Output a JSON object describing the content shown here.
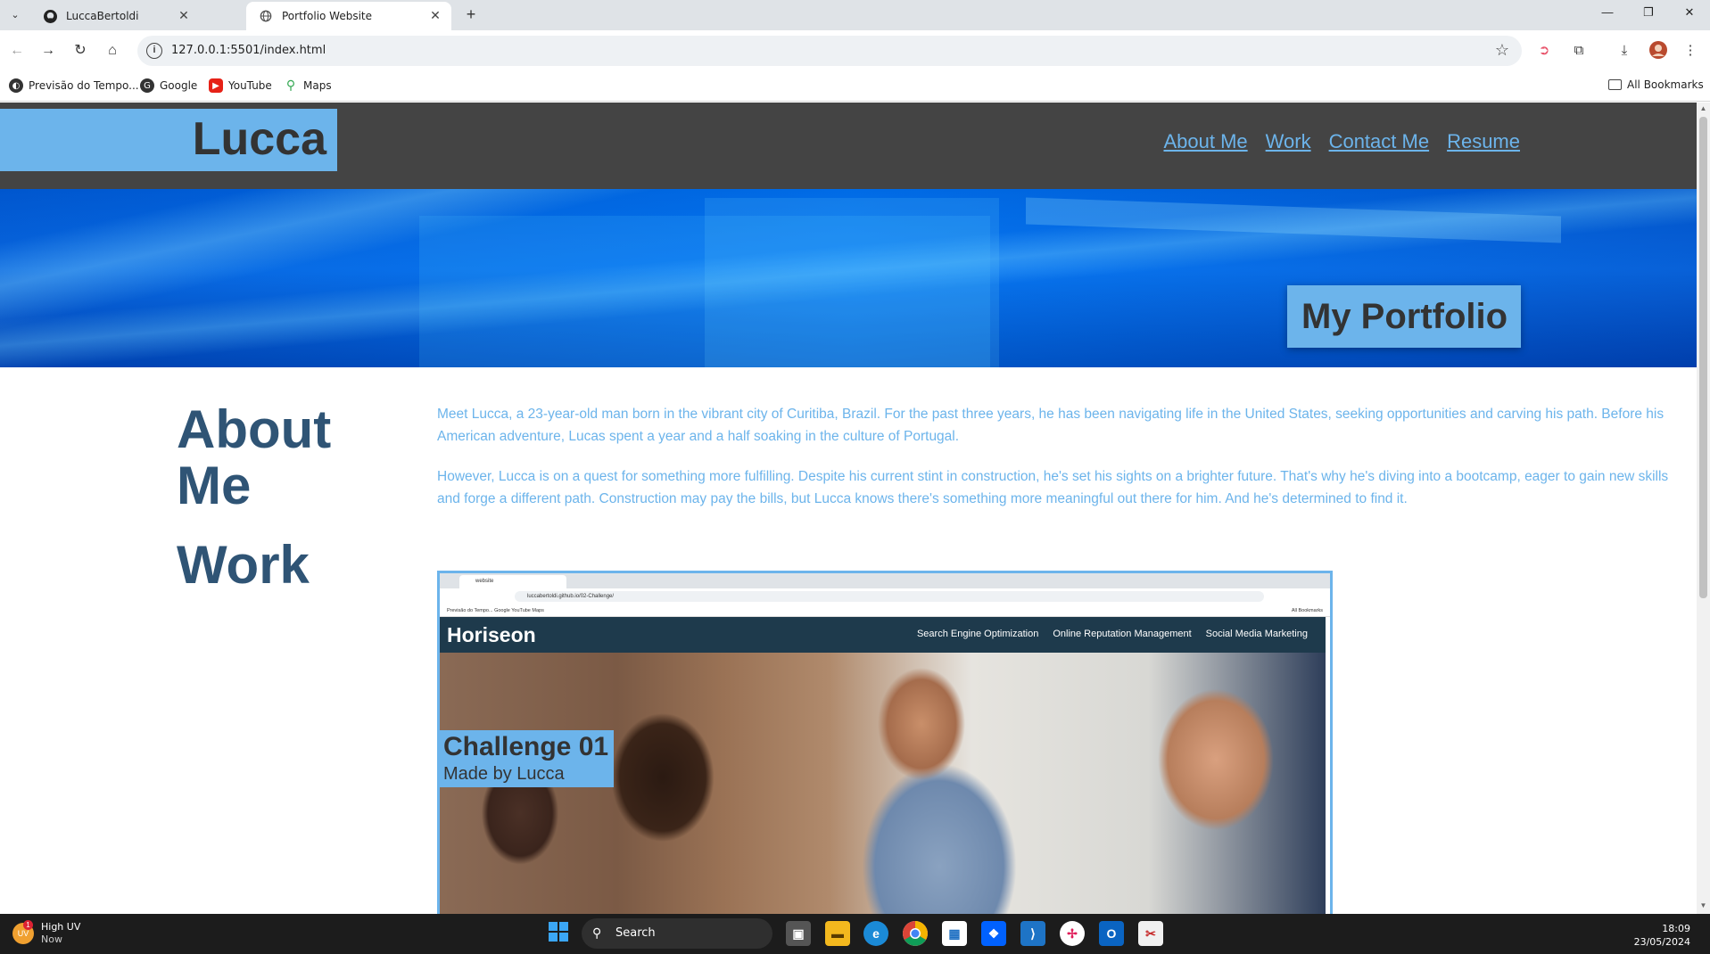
{
  "browser": {
    "tabs": [
      {
        "title": "LuccaBertoldi",
        "icon": "github-icon",
        "active": false
      },
      {
        "title": "Portfolio Website",
        "icon": "globe-icon",
        "active": true
      }
    ],
    "url": "127.0.0.1:5501/index.html",
    "bookmarks": [
      {
        "label": "Previsão do Tempo...",
        "icon": "weather-icon"
      },
      {
        "label": "Google",
        "icon": "google-icon"
      },
      {
        "label": "YouTube",
        "icon": "youtube-icon"
      },
      {
        "label": "Maps",
        "icon": "maps-icon"
      }
    ],
    "all_bookmarks": "All Bookmarks"
  },
  "site": {
    "logo": "Lucca",
    "nav": [
      "About Me",
      "Work",
      "Contact Me",
      "Resume"
    ],
    "hero_badge": "My Portfolio",
    "about": {
      "heading_line1": "About",
      "heading_line2": "Me",
      "paragraph1": "Meet Lucca, a 23-year-old man born in the vibrant city of Curitiba, Brazil. For the past three years, he has been navigating life in the United States, seeking opportunities and carving his path. Before his American adventure, Lucas spent a year and a half soaking in the culture of Portugal.",
      "paragraph2": "However, Lucca is on a quest for something more fulfilling. Despite his current stint in construction, he's set his sights on a brighter future. That's why he's diving into a bootcamp, eager to gain new skills and forge a different path. Construction may pay the bills, but Lucca knows there's something more meaningful out there for him. And he's determined to find it."
    },
    "work": {
      "heading": "Work",
      "project": {
        "mini_tab": "website",
        "mini_url": "luccabertoldi.github.io/02-Challenge/",
        "mini_bookmarks": "Previsão do Tempo...   Google   YouTube   Maps",
        "mini_all_bookmarks": "All Bookmarks",
        "brand": "Horiseon",
        "links": [
          "Search Engine Optimization",
          "Online Reputation Management",
          "Social Media Marketing"
        ],
        "title": "Challenge 01",
        "subtitle": "Made by Lucca"
      }
    }
  },
  "taskbar": {
    "weather_title": "High UV",
    "weather_sub": "Now",
    "weather_badge": "1",
    "search_label": "Search",
    "time": "18:09",
    "date": "23/05/2024"
  },
  "colors": {
    "accent": "#6cb4eb",
    "header_bg": "#444444",
    "heading": "#2f5475"
  }
}
